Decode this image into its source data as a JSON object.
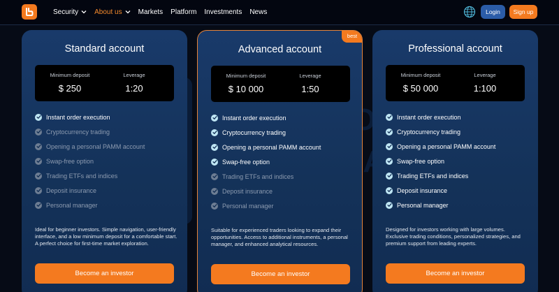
{
  "nav": {
    "links": [
      {
        "label": "Security",
        "dropdown": true,
        "active": false
      },
      {
        "label": "About us",
        "dropdown": true,
        "active": true
      },
      {
        "label": "Markets",
        "dropdown": false,
        "active": false
      },
      {
        "label": "Platform",
        "dropdown": false,
        "active": false
      },
      {
        "label": "Investments",
        "dropdown": false,
        "active": false
      },
      {
        "label": "News",
        "dropdown": false,
        "active": false
      }
    ],
    "login_label": "Login",
    "signup_label": "Sign up",
    "icons": {
      "logo": "brand-logo-icon",
      "language": "globe-icon"
    }
  },
  "watermark_text": [
    "BROKER",
    "RIBUNAL"
  ],
  "colors": {
    "accent": "#f47a1f",
    "active_link": "#f48a2c",
    "login": "#2b5ca8",
    "card_bg": "#163563",
    "check_on": "#bfe6f4",
    "check_off": "#6d7d93"
  },
  "cards": [
    {
      "title": "Standard account",
      "badge": "",
      "deposit_label": "Minimum deposit",
      "deposit_value": "$ 250",
      "leverage_label": "Leverage",
      "leverage_value": "1:20",
      "features": [
        {
          "label": "Instant order execution",
          "included": true
        },
        {
          "label": "Cryptocurrency trading",
          "included": false
        },
        {
          "label": "Opening a personal PAMM account",
          "included": false
        },
        {
          "label": "Swap-free option",
          "included": false
        },
        {
          "label": "Trading ETFs and indices",
          "included": false
        },
        {
          "label": "Deposit insurance",
          "included": false
        },
        {
          "label": "Personal manager",
          "included": false
        }
      ],
      "description": "Ideal for beginner investors. Simple navigation, user-friendly interface, and a low minimum deposit for a comfortable start. A perfect choice for first-time market exploration.",
      "cta": "Become an investor"
    },
    {
      "title": "Advanced account",
      "badge": "best",
      "deposit_label": "Minimum deposit",
      "deposit_value": "$ 10 000",
      "leverage_label": "Leverage",
      "leverage_value": "1:50",
      "features": [
        {
          "label": "Instant order execution",
          "included": true
        },
        {
          "label": "Cryptocurrency trading",
          "included": true
        },
        {
          "label": "Opening a personal PAMM account",
          "included": true
        },
        {
          "label": "Swap-free option",
          "included": true
        },
        {
          "label": "Trading ETFs and indices",
          "included": false
        },
        {
          "label": "Deposit insurance",
          "included": false
        },
        {
          "label": "Personal manager",
          "included": false
        }
      ],
      "description": "Suitable for experienced traders looking to expand their opportunities. Access to additional instruments, a personal manager, and enhanced analytical resources.",
      "cta": "Become an investor"
    },
    {
      "title": "Professional account",
      "badge": "",
      "deposit_label": "Minimum deposit",
      "deposit_value": "$ 50 000",
      "leverage_label": "Leverage",
      "leverage_value": "1:100",
      "features": [
        {
          "label": "Instant order execution",
          "included": true
        },
        {
          "label": "Cryptocurrency trading",
          "included": true
        },
        {
          "label": "Opening a personal PAMM account",
          "included": true
        },
        {
          "label": "Swap-free option",
          "included": true
        },
        {
          "label": "Trading ETFs and indices",
          "included": true
        },
        {
          "label": "Deposit insurance",
          "included": true
        },
        {
          "label": "Personal manager",
          "included": true
        }
      ],
      "description": "Designed for investors working with large volumes. Exclusive trading conditions, personalized strategies, and premium support from leading experts.",
      "cta": "Become an investor"
    }
  ]
}
